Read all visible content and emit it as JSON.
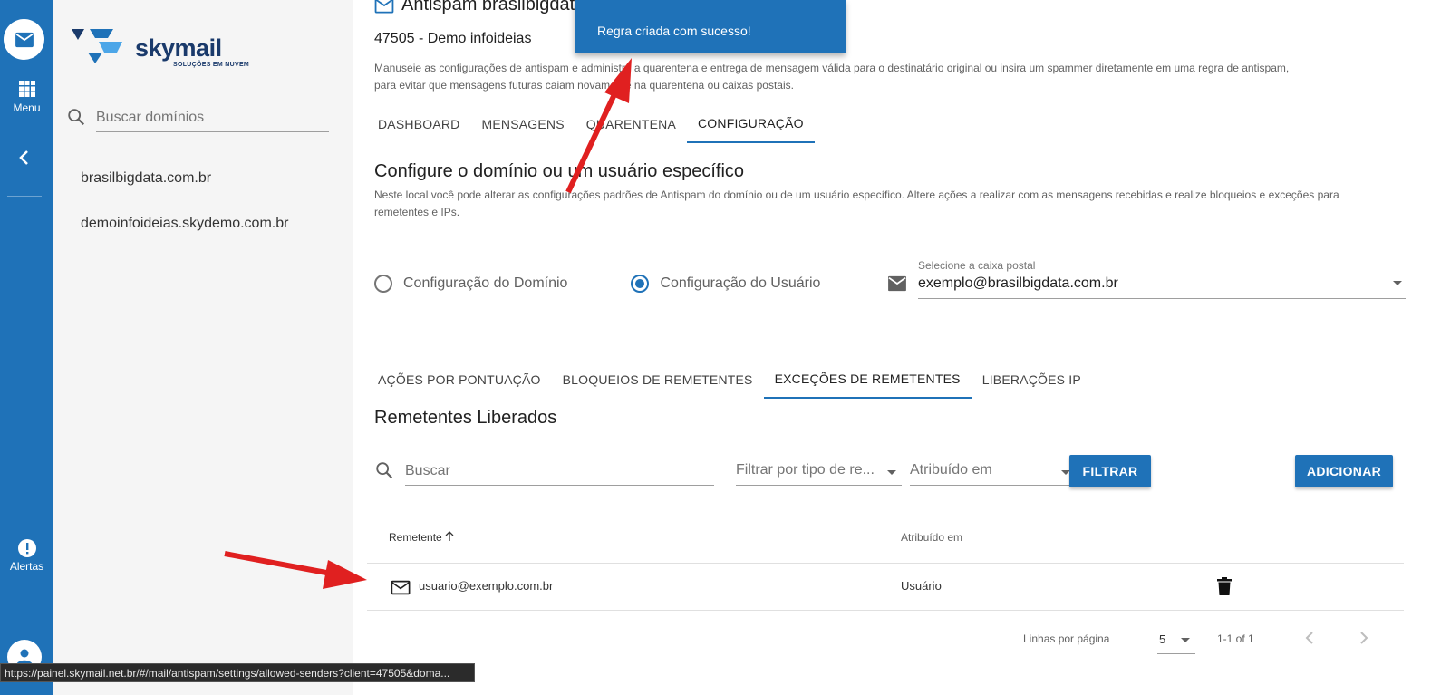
{
  "rail": {
    "menu_label": "Menu",
    "alerts_label": "Alertas"
  },
  "sidebar": {
    "logo_text": "skymail",
    "logo_sub": "SOLUÇÕES EM NUVEM",
    "search_placeholder": "Buscar domínios",
    "domains": [
      "brasilbigdata.com.br",
      "demoinfoideias.skydemo.com.br"
    ]
  },
  "header": {
    "title": "Antispam brasilbigdat",
    "subtitle": "47505 - Demo infoideias",
    "description_line1": "Manuseie as configurações de antispam e administre a quarentena e entrega de mensagem válida para o destinatário original ou insira um spammer diretamente em uma regra de antispam,",
    "description_line2": "para evitar que mensagens futuras caiam novamente na quarentena ou caixas postais."
  },
  "tabs": [
    "DASHBOARD",
    "MENSAGENS",
    "QUARENTENA",
    "CONFIGURAÇÃO"
  ],
  "config": {
    "title": "Configure o domínio ou um usuário específico",
    "description": "Neste local você pode alterar as configurações padrões de Antispam do domínio ou de um usuário específico. Altere ações a realizar com as mensagens recebidas e realize bloqueios e exceções para remetentes e IPs.",
    "radio_domain": "Configuração do Domínio",
    "radio_user": "Configuração do Usuário",
    "mailbox_label": "Selecione a caixa postal",
    "mailbox_value": "exemplo@brasilbigdata.com.br"
  },
  "subtabs": [
    "AÇÕES POR PONTUAÇÃO",
    "BLOQUEIOS DE REMETENTES",
    "EXCEÇÕES DE REMETENTES",
    "LIBERAÇÕES IP"
  ],
  "list": {
    "title": "Remetentes Liberados",
    "search_placeholder": "Buscar",
    "filter_type": "Filtrar por tipo de re...",
    "filter_assigned": "Atribuído em",
    "filter_button": "FILTRAR",
    "add_button": "ADICIONAR",
    "col_sender": "Remetente",
    "col_assigned": "Atribuído em",
    "rows": [
      {
        "sender": "usuario@exemplo.com.br",
        "assigned": "Usuário"
      }
    ],
    "rows_per_page_label": "Linhas por página",
    "rows_per_page": "5",
    "range": "1-1 of 1"
  },
  "toast": {
    "message": "Regra criada com sucesso!"
  },
  "statusbar": {
    "url": "https://painel.skymail.net.br/#/mail/antispam/settings/allowed-senders?client=47505&doma..."
  },
  "colors": {
    "primary": "#1f72b8",
    "annotation_arrow": "#e02020"
  }
}
